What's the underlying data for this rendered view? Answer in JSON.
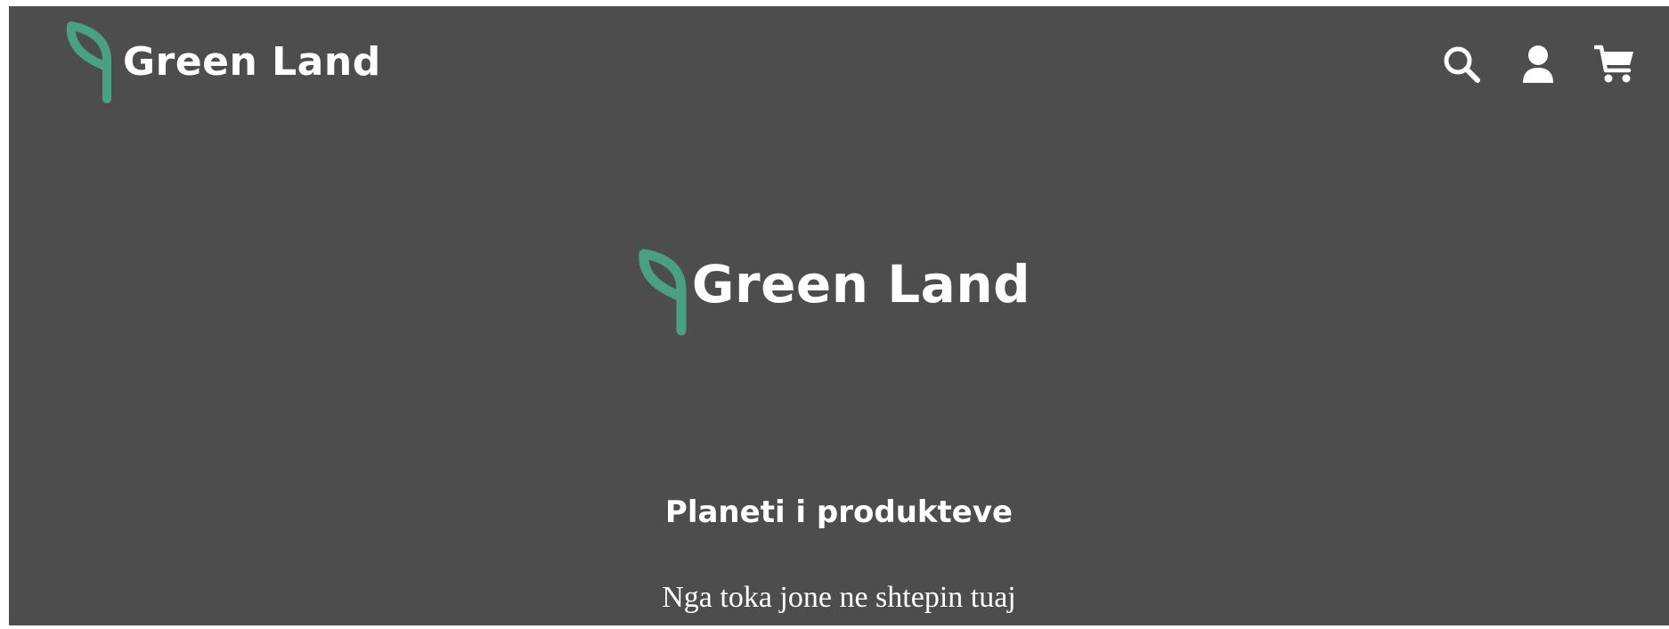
{
  "header": {
    "brand_name": "Green Land",
    "logo_icon": "leaf-icon",
    "icons": [
      "search-icon",
      "user-icon",
      "cart-icon"
    ]
  },
  "hero": {
    "brand_name": "Green Land",
    "logo_icon": "leaf-icon"
  },
  "tagline": "Planeti i produkteve",
  "subtitle": "Nga toka jone ne shtepin tuaj",
  "colors": {
    "background": "#4d4d4d",
    "accent_leaf": "#4aa083",
    "text": "#ffffff"
  }
}
